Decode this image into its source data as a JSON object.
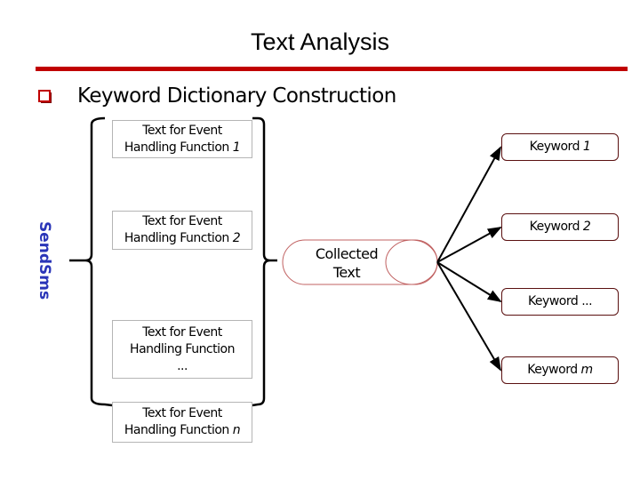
{
  "header": {
    "title": "Text Analysis",
    "accent_color": "#c00000"
  },
  "section": {
    "bullet_icon": "checkbox-square-icon",
    "heading": "Keyword Dictionary Construction"
  },
  "diagram": {
    "group_label": "SendSms",
    "group_label_color": "#2a35b8",
    "event_texts": [
      {
        "prefix": "Text for Event",
        "line2": "Handling Function",
        "index": "1"
      },
      {
        "prefix": "Text for Event",
        "line2": "Handling Function",
        "index": "2"
      },
      {
        "prefix": "Text for Event",
        "line2": "Handling Function",
        "index": "..."
      },
      {
        "prefix": "Text for Event",
        "line2": "Handling Function",
        "index": "n"
      }
    ],
    "collected": {
      "line1": "Collected",
      "line2": "Text",
      "border_color": "#c06060"
    },
    "keywords": [
      {
        "label": "Keyword",
        "index": "1"
      },
      {
        "label": "Keyword",
        "index": "2"
      },
      {
        "label": "Keyword",
        "index": "..."
      },
      {
        "label": "Keyword",
        "index": "m"
      }
    ],
    "keyword_border_color": "#5a1010"
  }
}
